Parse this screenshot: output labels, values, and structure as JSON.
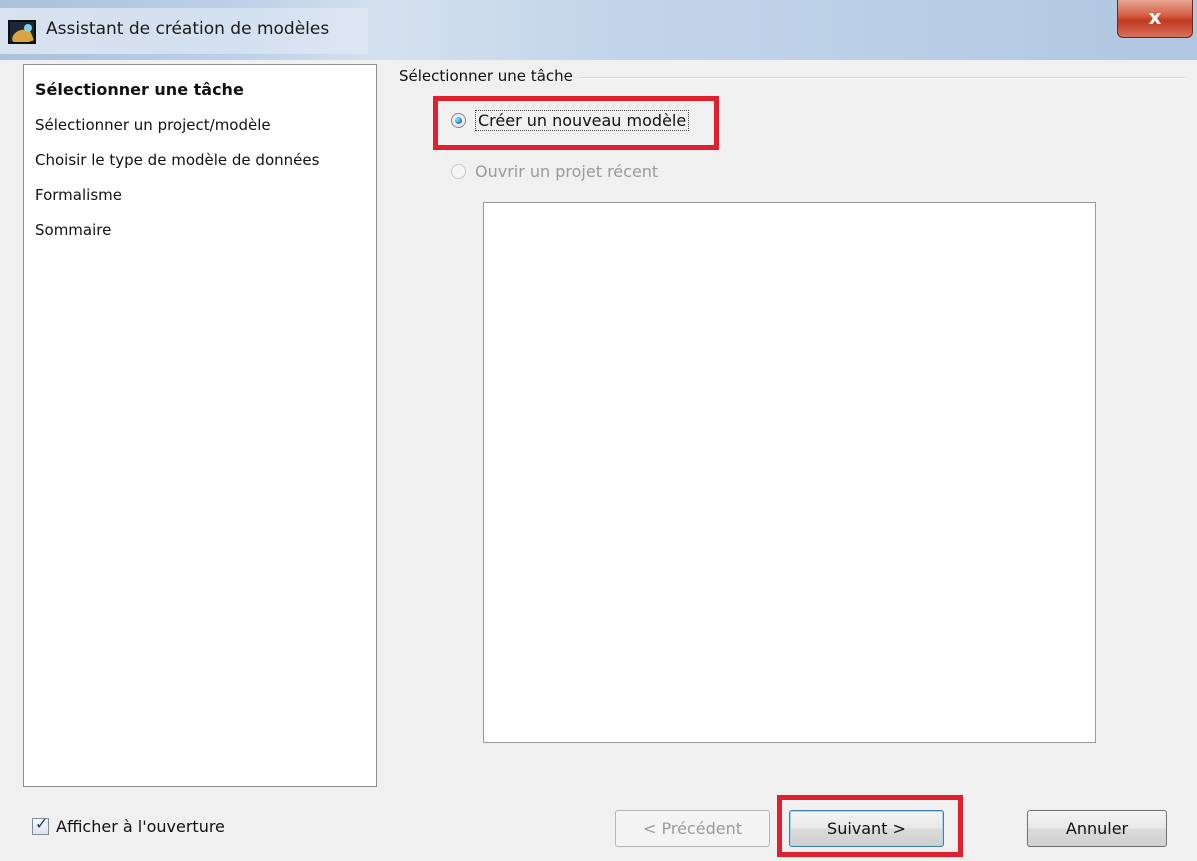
{
  "window": {
    "title": "Assistant de création de modèles",
    "close_icon": "close-x-icon",
    "close_glyph": "x"
  },
  "nav": {
    "items": [
      {
        "label": "Sélectionner une tâche",
        "active": true
      },
      {
        "label": "Sélectionner un project/modèle",
        "active": false
      },
      {
        "label": "Choisir le type de modèle de données",
        "active": false
      },
      {
        "label": "Formalisme",
        "active": false
      },
      {
        "label": "Sommaire",
        "active": false
      }
    ]
  },
  "task_group": {
    "title": "Sélectionner une tâche",
    "options": [
      {
        "label": "Créer un nouveau modèle",
        "checked": true,
        "enabled": true
      },
      {
        "label": "Ouvrir un projet récent",
        "checked": false,
        "enabled": false
      }
    ]
  },
  "footer": {
    "show_on_open_label": "Afficher à l'ouverture",
    "show_on_open_checked": true,
    "checkmark_glyph": "✓",
    "previous_label": "< Précédent",
    "next_label": "Suivant >",
    "cancel_label": "Annuler"
  },
  "colors": {
    "highlight": "#e0202e",
    "window_bg": "#f0f0f0",
    "close_button": "#c8432a"
  }
}
